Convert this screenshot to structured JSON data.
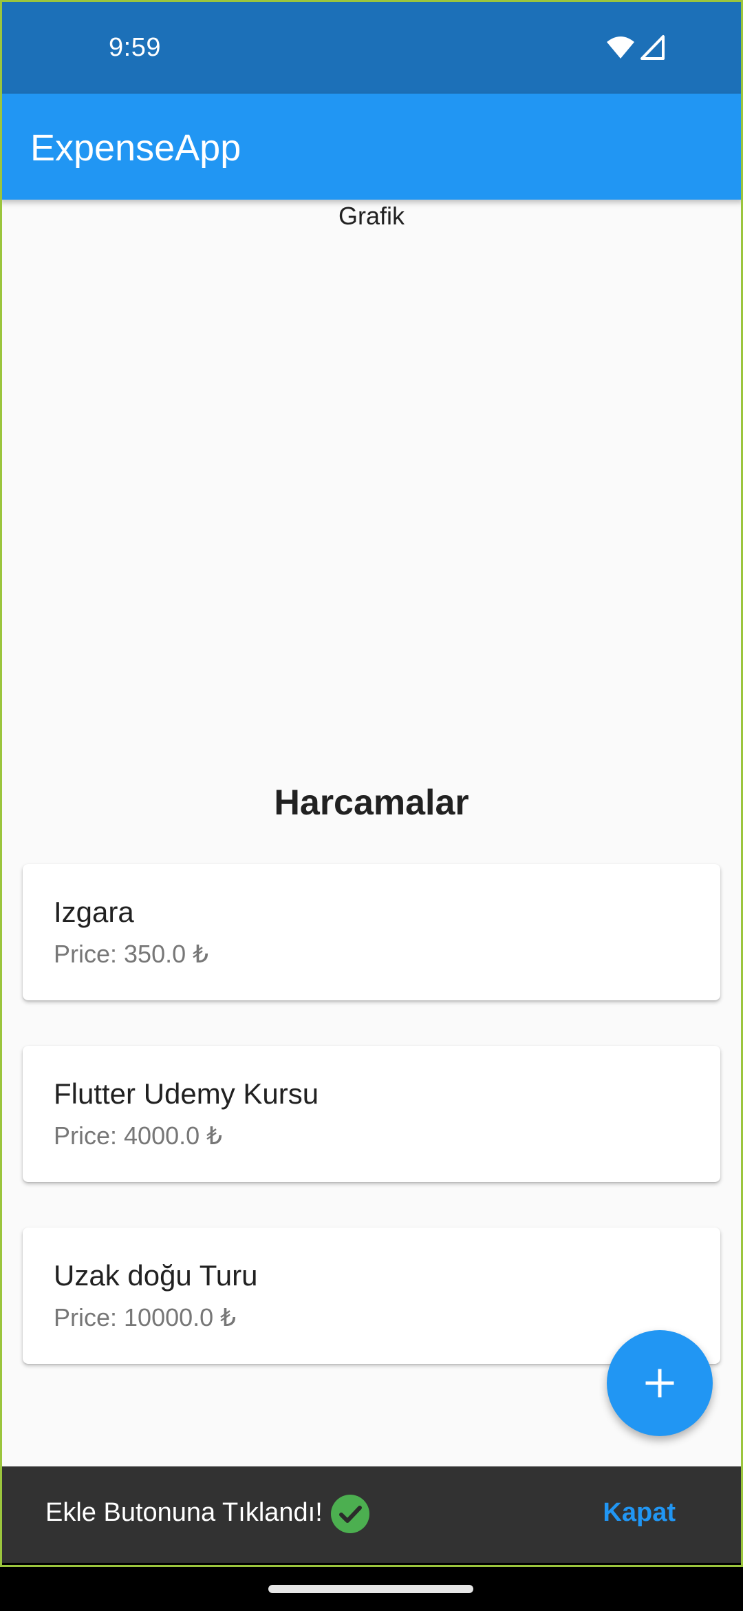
{
  "status_bar": {
    "time": "9:59",
    "icons": [
      "wifi-icon",
      "cellular-signal-icon"
    ]
  },
  "app_bar": {
    "title": "ExpenseApp"
  },
  "chart_area": {
    "label": "Grafik"
  },
  "expenses": {
    "heading": "Harcamalar",
    "items": [
      {
        "title": "Izgara",
        "price": "Price: 350.0 ₺"
      },
      {
        "title": "Flutter Udemy Kursu",
        "price": "Price: 4000.0 ₺"
      },
      {
        "title": "Uzak doğu Turu",
        "price": "Price: 10000.0 ₺"
      }
    ]
  },
  "fab": {
    "icon": "plus-icon"
  },
  "snackbar": {
    "message": "Ekle Butonuna Tıklandı!",
    "icon": "check-circle-icon",
    "action_label": "Kapat"
  },
  "colors": {
    "primary": "#2196f3",
    "status_bar": "#1c70b8",
    "snackbar_bg": "#323232",
    "success": "#4caf50"
  }
}
